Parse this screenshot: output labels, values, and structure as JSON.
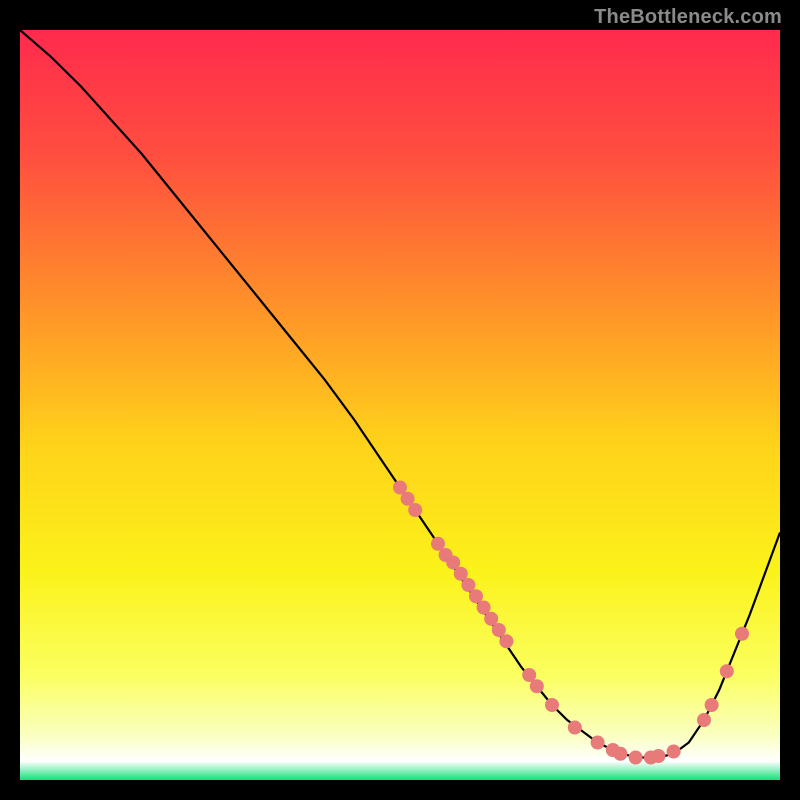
{
  "attribution": "TheBottleneck.com",
  "chart_data": {
    "type": "line",
    "title": "",
    "xlabel": "",
    "ylabel": "",
    "xlim": [
      0,
      100
    ],
    "ylim": [
      0,
      100
    ],
    "background_gradient_stops": [
      {
        "offset": 0.0,
        "color": "#ff2a4d"
      },
      {
        "offset": 0.17,
        "color": "#ff4f3f"
      },
      {
        "offset": 0.36,
        "color": "#ff8f2a"
      },
      {
        "offset": 0.55,
        "color": "#ffd21a"
      },
      {
        "offset": 0.72,
        "color": "#fbf21a"
      },
      {
        "offset": 0.86,
        "color": "#fbff60"
      },
      {
        "offset": 0.94,
        "color": "#faffc0"
      },
      {
        "offset": 0.975,
        "color": "#ffffff"
      },
      {
        "offset": 1.0,
        "color": "#15e07a"
      }
    ],
    "series": [
      {
        "name": "bottleneck-curve",
        "color": "#000000",
        "x": [
          0,
          4,
          8,
          12,
          16,
          20,
          24,
          28,
          32,
          36,
          40,
          44,
          48,
          50,
          52,
          54,
          56,
          58,
          60,
          62,
          64,
          66,
          68,
          70,
          72,
          74,
          76,
          78,
          80,
          82,
          84,
          86,
          88,
          90,
          92,
          94,
          96,
          98,
          100
        ],
        "y": [
          100,
          96.5,
          92.5,
          88,
          83.5,
          78.5,
          73.5,
          68.5,
          63.5,
          58.5,
          53.5,
          48,
          42,
          39,
          36,
          33,
          30,
          27,
          24,
          21,
          18,
          15,
          12.5,
          10,
          8,
          6.5,
          5,
          4,
          3.3,
          3,
          3,
          3.5,
          5,
          8,
          12,
          17,
          22,
          27.5,
          33
        ]
      }
    ],
    "scatter_points": {
      "name": "highlight-points",
      "color": "#e87a7a",
      "radius": 7,
      "points": [
        {
          "x": 50,
          "y": 39
        },
        {
          "x": 51,
          "y": 37.5
        },
        {
          "x": 52,
          "y": 36
        },
        {
          "x": 55,
          "y": 31.5
        },
        {
          "x": 56,
          "y": 30
        },
        {
          "x": 57,
          "y": 29
        },
        {
          "x": 58,
          "y": 27.5
        },
        {
          "x": 59,
          "y": 26
        },
        {
          "x": 60,
          "y": 24.5
        },
        {
          "x": 61,
          "y": 23
        },
        {
          "x": 62,
          "y": 21.5
        },
        {
          "x": 63,
          "y": 20
        },
        {
          "x": 64,
          "y": 18.5
        },
        {
          "x": 67,
          "y": 14
        },
        {
          "x": 68,
          "y": 12.5
        },
        {
          "x": 70,
          "y": 10
        },
        {
          "x": 73,
          "y": 7
        },
        {
          "x": 76,
          "y": 5
        },
        {
          "x": 78,
          "y": 4
        },
        {
          "x": 79,
          "y": 3.5
        },
        {
          "x": 81,
          "y": 3
        },
        {
          "x": 83,
          "y": 3
        },
        {
          "x": 84,
          "y": 3.2
        },
        {
          "x": 86,
          "y": 3.8
        },
        {
          "x": 90,
          "y": 8
        },
        {
          "x": 91,
          "y": 10
        },
        {
          "x": 93,
          "y": 14.5
        },
        {
          "x": 95,
          "y": 19.5
        }
      ]
    }
  }
}
